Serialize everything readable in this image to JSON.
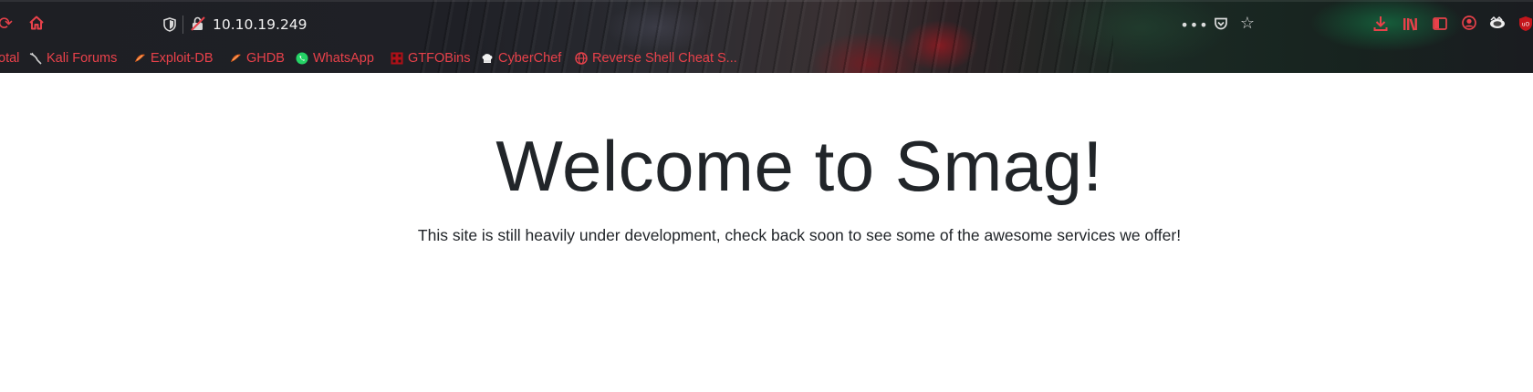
{
  "browser": {
    "url": "10.10.19.249",
    "accent_color": "#e8414a",
    "toolbar_icons": [
      "reload-icon",
      "home-icon",
      "shield-icon",
      "insecure-lock-icon",
      "page-actions-icon",
      "pocket-icon",
      "bookmark-star-icon",
      "download-icon",
      "library-icon",
      "sidebar-icon",
      "account-icon",
      "extension-icon",
      "ublock-icon"
    ]
  },
  "bookmarks": [
    {
      "label": "otal",
      "icon": "bookmark-icon"
    },
    {
      "label": "Kali Forums",
      "icon": "kali-icon"
    },
    {
      "label": "Exploit-DB",
      "icon": "exploit-db-icon"
    },
    {
      "label": "GHDB",
      "icon": "ghdb-icon"
    },
    {
      "label": "WhatsApp",
      "icon": "whatsapp-icon"
    },
    {
      "label": "GTFOBins",
      "icon": "gtfobins-icon"
    },
    {
      "label": "CyberChef",
      "icon": "cyberchef-icon"
    },
    {
      "label": "Reverse Shell Cheat S...",
      "icon": "globe-icon"
    }
  ],
  "page": {
    "heading": "Welcome to Smag!",
    "text": "This site is still heavily under development, check back soon to see some of the awesome services we offer!"
  }
}
